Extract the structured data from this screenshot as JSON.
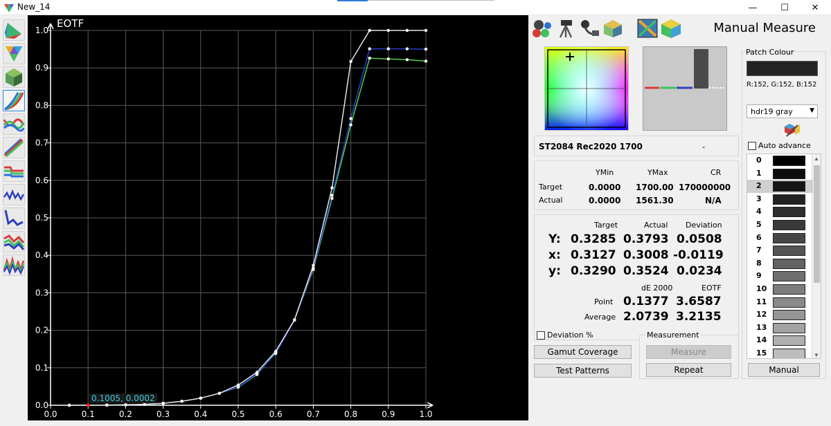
{
  "window": {
    "title": "New_14",
    "minimize": "—",
    "maximize": "☐",
    "close": "✕"
  },
  "left_toolbar": {
    "tools": [
      "cie-diagram",
      "gamut-triangle",
      "3d-gamut",
      "rgb-gamma-curves",
      "rgb-balance",
      "luminance-ramp",
      "color-temperature",
      "de-graph",
      "de-trend",
      "rgb-levels",
      "rgb-noise"
    ],
    "active": 3
  },
  "chart": {
    "title": "EOTF",
    "cursor_readout": "0.1005, 0.0002",
    "colors": {
      "white": "#e6e6e6",
      "green": "#4fd34f",
      "blue": "#2c3ecf",
      "points": "#ffffff",
      "grid": "#5a5a5a",
      "cursor": "#ff2020"
    },
    "chart_data": {
      "type": "line",
      "title": "EOTF",
      "xlim": [
        0.0,
        1.0
      ],
      "ylim": [
        0.0,
        1.0
      ],
      "grid": true,
      "x_ticks": [
        "0.0",
        "0.1",
        "0.2",
        "0.3",
        "0.4",
        "0.5",
        "0.6",
        "0.7",
        "0.8",
        "0.9",
        "1.0"
      ],
      "y_ticks": [
        "0.0",
        "0.1",
        "0.2",
        "0.3",
        "0.4",
        "0.5",
        "0.6",
        "0.7",
        "0.8",
        "0.9",
        "1.0"
      ],
      "series": [
        {
          "color": "#e6e6e6",
          "x": [
            0.05,
            0.1,
            0.15,
            0.2,
            0.25,
            0.3,
            0.35,
            0.4,
            0.45,
            0.5,
            0.55,
            0.6,
            0.65,
            0.7,
            0.75,
            0.8,
            0.85,
            0.9,
            0.95,
            1.0
          ],
          "y": [
            0.0,
            0.0002,
            0.0006,
            0.0012,
            0.0025,
            0.0052,
            0.0107,
            0.019,
            0.032,
            0.054,
            0.088,
            0.144,
            0.228,
            0.373,
            0.58,
            0.917,
            1.0,
            1.0,
            1.0,
            1.0
          ]
        },
        {
          "color": "#2c3ecf",
          "x": [
            0.05,
            0.1,
            0.15,
            0.2,
            0.25,
            0.3,
            0.35,
            0.4,
            0.45,
            0.5,
            0.55,
            0.6,
            0.65,
            0.7,
            0.75,
            0.8,
            0.85,
            0.9,
            0.95,
            1.0
          ],
          "y": [
            0.0,
            0.0002,
            0.0006,
            0.0012,
            0.0025,
            0.0052,
            0.0107,
            0.019,
            0.032,
            0.049,
            0.084,
            0.138,
            0.227,
            0.366,
            0.56,
            0.765,
            0.951,
            0.951,
            0.951,
            0.95
          ]
        },
        {
          "color": "#4fd34f",
          "x": [
            0.05,
            0.1,
            0.15,
            0.2,
            0.25,
            0.3,
            0.35,
            0.4,
            0.45,
            0.5,
            0.55,
            0.6,
            0.65,
            0.7,
            0.75,
            0.8,
            0.85,
            0.9,
            0.95,
            1.0
          ],
          "y": [
            0.0,
            0.0002,
            0.0006,
            0.0012,
            0.0025,
            0.0052,
            0.0107,
            0.019,
            0.032,
            0.048,
            0.082,
            0.14,
            0.228,
            0.362,
            0.552,
            0.748,
            0.926,
            0.924,
            0.922,
            0.918
          ]
        }
      ]
    }
  },
  "panel": {
    "heading": "Manual Measure",
    "top_tools": [
      "rgb-balls-icon",
      "meter-tripod-icon",
      "probe-icon",
      "3d-patch-icon",
      "pattern-gen-icon",
      "color-cube-icon"
    ],
    "mode_label": "ST2084 Rec2020 1700",
    "mode_value": "-",
    "ymin_table": {
      "headers": [
        "YMin",
        "YMax",
        "CR"
      ],
      "rows": [
        {
          "label": "Target",
          "ymin": "0.0000",
          "ymax": "1700.00",
          "cr": "170000000"
        },
        {
          "label": "Actual",
          "ymin": "0.0000",
          "ymax": "1561.30",
          "cr": "N/A"
        }
      ]
    },
    "measure_table": {
      "headers": [
        "Target",
        "Actual",
        "Deviation"
      ],
      "rows": [
        {
          "label": "Y:",
          "target": "0.3285",
          "actual": "0.3793",
          "deviation": "0.0508"
        },
        {
          "label": "x:",
          "target": "0.3127",
          "actual": "0.3008",
          "deviation": "-0.0119"
        },
        {
          "label": "y:",
          "target": "0.3290",
          "actual": "0.3524",
          "deviation": "0.0234"
        }
      ],
      "de_headers": [
        "dE 2000",
        "EOTF"
      ],
      "de_rows": [
        {
          "label": "Point",
          "de": "0.1377",
          "eotf": "3.6587"
        },
        {
          "label": "Average",
          "de": "2.0739",
          "eotf": "3.2135"
        }
      ]
    },
    "deviation_pct_label": "Deviation %",
    "measurement_group_label": "Measurement",
    "buttons": {
      "gamut_coverage": "Gamut Coverage",
      "test_patterns": "Test Patterns",
      "measure": "Measure",
      "repeat": "Repeat",
      "manual": "Manual"
    },
    "patch_colour": {
      "label": "Patch Colour",
      "swatch_color": "#232323",
      "rgb_text": "R:152, G:152, B:152",
      "sequence": "hdr19 gray",
      "auto_advance": "Auto advance",
      "selected_index": 2,
      "patches": [
        {
          "num": "0",
          "color": "#000000"
        },
        {
          "num": "1",
          "color": "#0d0d0d"
        },
        {
          "num": "2",
          "color": "#161616"
        },
        {
          "num": "3",
          "color": "#222222"
        },
        {
          "num": "4",
          "color": "#2d2d2d"
        },
        {
          "num": "5",
          "color": "#3a3a3a"
        },
        {
          "num": "6",
          "color": "#474747"
        },
        {
          "num": "7",
          "color": "#545454"
        },
        {
          "num": "8",
          "color": "#626262"
        },
        {
          "num": "9",
          "color": "#6f6f6f"
        },
        {
          "num": "10",
          "color": "#7c7c7c"
        },
        {
          "num": "11",
          "color": "#898989"
        },
        {
          "num": "12",
          "color": "#969696"
        },
        {
          "num": "13",
          "color": "#a3a3a3"
        },
        {
          "num": "14",
          "color": "#b0b0b0"
        },
        {
          "num": "15",
          "color": "#bdbdbd"
        }
      ]
    }
  }
}
